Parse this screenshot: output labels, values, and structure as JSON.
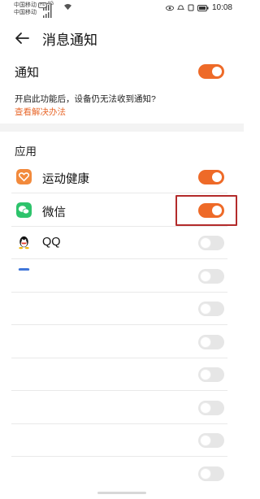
{
  "status_bar": {
    "carrier_1": "中国移动",
    "carrier_1_badge": "HD",
    "carrier_2": "中国移动",
    "signal_label": "4G",
    "time": "10:08"
  },
  "header": {
    "title": "消息通知"
  },
  "notifications": {
    "label": "通知",
    "enabled": true,
    "hint": "开启此功能后，设备仍无法收到通知?",
    "hint_link": "查看解决办法"
  },
  "apps": {
    "section_title": "应用",
    "items": [
      {
        "name": "运动健康",
        "icon": "health-app-icon",
        "enabled": true
      },
      {
        "name": "微信",
        "icon": "wechat-app-icon",
        "enabled": true
      },
      {
        "name": "QQ",
        "icon": "qq-app-icon",
        "enabled": false
      },
      {
        "name": "",
        "icon": "partial-app-icon",
        "enabled": false
      },
      {
        "name": "",
        "icon": "",
        "enabled": false
      },
      {
        "name": "",
        "icon": "",
        "enabled": false
      },
      {
        "name": "",
        "icon": "",
        "enabled": false
      },
      {
        "name": "",
        "icon": "",
        "enabled": false
      },
      {
        "name": "",
        "icon": "",
        "enabled": false
      },
      {
        "name": "",
        "icon": "",
        "enabled": false
      }
    ]
  },
  "colors": {
    "accent": "#ee6a28",
    "highlight": "#b32b2b",
    "toggle_off": "#e6e6e6"
  }
}
